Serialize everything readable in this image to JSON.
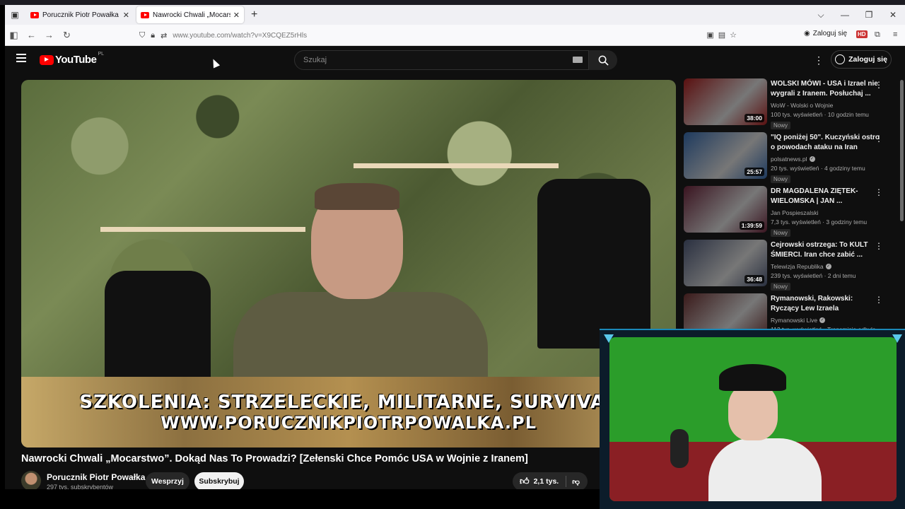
{
  "browser": {
    "tabs": [
      {
        "label": "Porucznik Piotr Powałka - YouT",
        "active": false
      },
      {
        "label": "Nawrocki Chwali „Mocarstwo”",
        "active": true
      }
    ],
    "url": "www.youtube.com/watch?v=X9CQEZ5rHls",
    "login_label": "Zaloguj się"
  },
  "youtube": {
    "logo_text": "YouTube",
    "country_code": "PL",
    "search_placeholder": "Szukaj",
    "signin_label": "Zaloguj się"
  },
  "video": {
    "banner_line1": "SZKOLENIA: STRZELECKIE, MILITARNE, SURVIVAL",
    "banner_line2": "WWW.PORUCZNIKPIOTRPOWALKA.PL",
    "title": "Nawrocki Chwali „Mocarstwo”. Dokąd Nas To Prowadzi? [Zełenski Chce Pomóc USA w Wojnie z Iranem]",
    "channel_name": "Porucznik Piotr Powałka",
    "subscribers": "297 tys. subskrybentów",
    "support_label": "Wesprzyj",
    "subscribe_label": "Subskrybuj",
    "likes": "2,1 tys."
  },
  "recommendations": [
    {
      "title": "WOLSKI MÓWI - USA i Izrael nie wygrali z Iranem. Posłuchaj ...",
      "channel": "WoW - Wolski o Wojnie",
      "verified": false,
      "meta": "100 tys. wyświetleń · 10 godzin temu",
      "badge": "Nowy",
      "duration": "38:00",
      "thumb_color": "#5a1010"
    },
    {
      "title": "\"IQ poniżej 50\". Kuczyński ostro o powodach ataku na Iran",
      "channel": "polsatnews.pl",
      "verified": true,
      "meta": "20 tys. wyświetleń · 4 godziny temu",
      "badge": "Nowy",
      "duration": "25:57",
      "thumb_color": "#1e3a5e"
    },
    {
      "title": "DR MAGDALENA ZIĘTEK-WIELOMSKA | JAN ...",
      "channel": "Jan Pospieszalski",
      "verified": false,
      "meta": "7,3 tys. wyświetleń · 3 godziny temu",
      "badge": "Nowy",
      "duration": "1:39:59",
      "thumb_color": "#3a1420"
    },
    {
      "title": "Cejrowski ostrzega: To KULT ŚMIERCI. Iran chce zabić ...",
      "channel": "Telewizja Republika",
      "verified": true,
      "meta": "239 tys. wyświetleń · 2 dni temu",
      "badge": "Nowy",
      "duration": "36:48",
      "thumb_color": "#2a3040"
    },
    {
      "title": "Rymanowski, Rakowski: Ryczący Lew Izraela",
      "channel": "Rymanowski Live",
      "verified": true,
      "meta": "112 tys. wyświetleń · Transmisja odbyła",
      "badge": "",
      "duration": "",
      "thumb_color": "#3a1a1a"
    }
  ]
}
